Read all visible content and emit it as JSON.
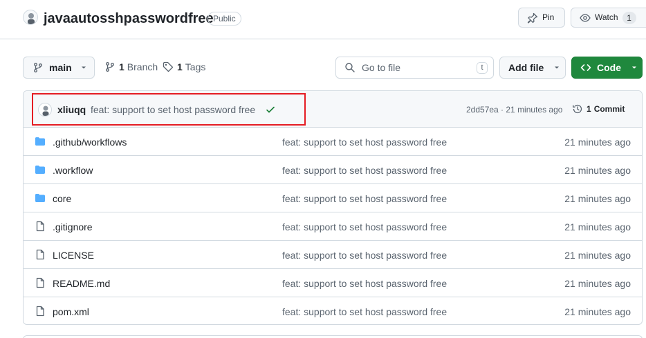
{
  "repo": {
    "name": "javaautosshpasswordfree",
    "visibility": "Public"
  },
  "header_actions": {
    "pin_label": "Pin",
    "watch_label": "Watch",
    "watch_count": "1"
  },
  "toolbar": {
    "branch": "main",
    "branches_count": "1",
    "branches_label": "Branch",
    "tags_count": "1",
    "tags_label": "Tags",
    "search_placeholder": "Go to file",
    "search_shortcut": "t",
    "add_file_label": "Add file",
    "code_label": "Code"
  },
  "latest_commit": {
    "author": "xliuqq",
    "message": "feat: support to set host password free",
    "status_icon": "check-icon",
    "hash_time": "2dd57ea · 21 minutes ago",
    "commits_count": "1",
    "commits_label": "Commit"
  },
  "files": [
    {
      "type": "directory",
      "icon": "folder-icon",
      "name": ".github/workflows",
      "message": "feat: support to set host password free",
      "date": "21 minutes ago"
    },
    {
      "type": "directory",
      "icon": "folder-icon",
      "name": ".workflow",
      "message": "feat: support to set host password free",
      "date": "21 minutes ago"
    },
    {
      "type": "directory",
      "icon": "folder-icon",
      "name": "core",
      "message": "feat: support to set host password free",
      "date": "21 minutes ago"
    },
    {
      "type": "file",
      "icon": "file-icon",
      "name": ".gitignore",
      "message": "feat: support to set host password free",
      "date": "21 minutes ago"
    },
    {
      "type": "file",
      "icon": "file-icon",
      "name": "LICENSE",
      "message": "feat: support to set host password free",
      "date": "21 minutes ago"
    },
    {
      "type": "file",
      "icon": "file-icon",
      "name": "README.md",
      "message": "feat: support to set host password free",
      "date": "21 minutes ago"
    },
    {
      "type": "file",
      "icon": "file-icon",
      "name": "pom.xml",
      "message": "feat: support to set host password free",
      "date": "21 minutes ago"
    }
  ],
  "colors": {
    "accent_green": "#1f883d",
    "folder_blue": "#54aeff",
    "highlight_red": "#e51c23",
    "muted_text": "#59636e",
    "border": "#d1d9e0"
  }
}
